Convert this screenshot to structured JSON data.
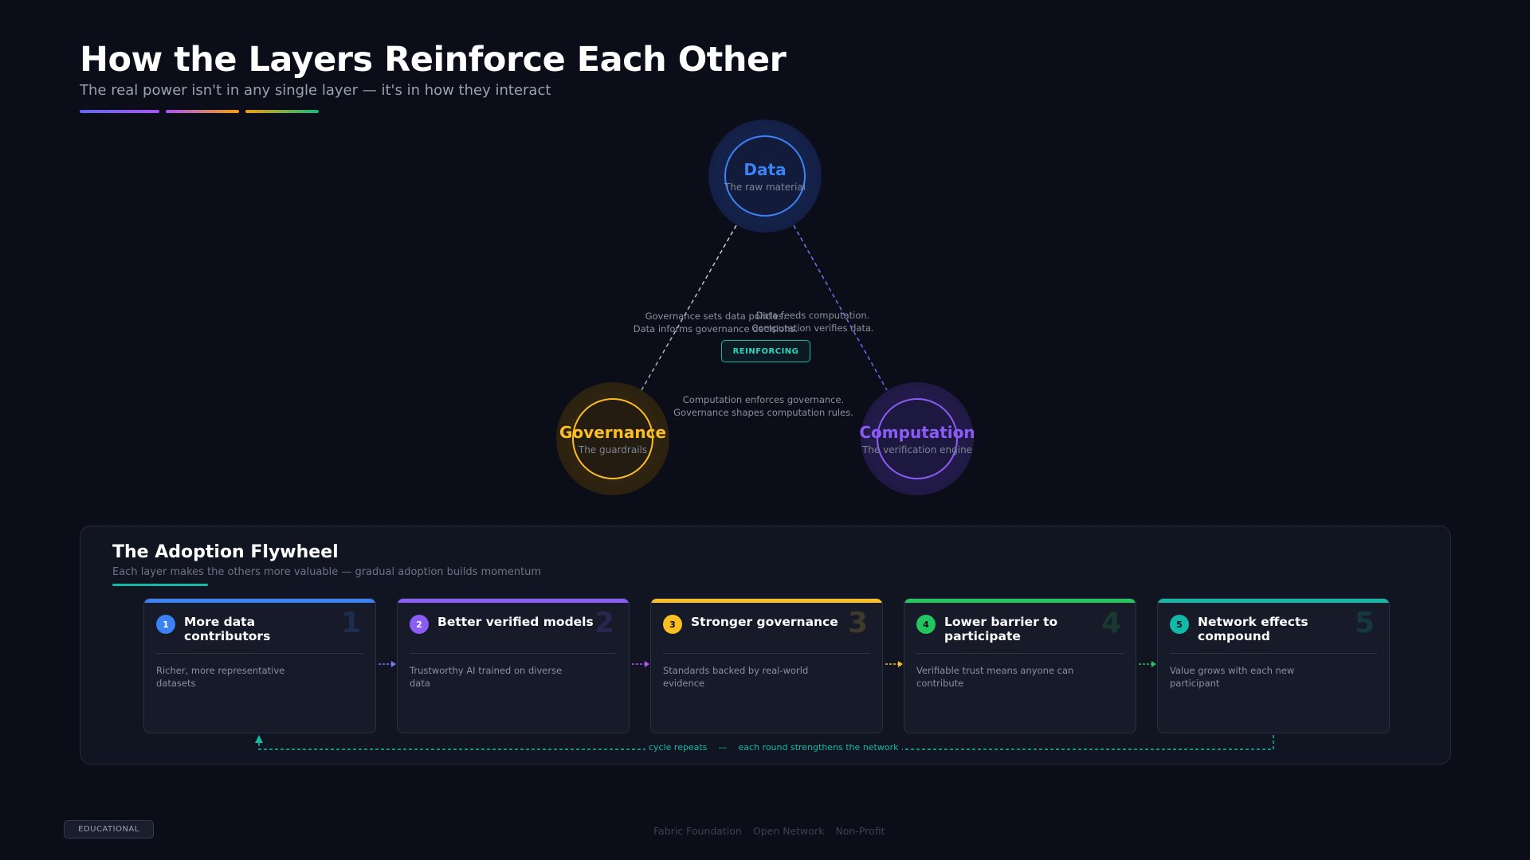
{
  "header": {
    "title": "How the Layers Reinforce Each Other",
    "subtitle": "The real power isn't in any single layer — it's in how they interact",
    "accent_bars": [
      "#6366f1",
      "#a855f7",
      "#f59e0b",
      "#10b981"
    ]
  },
  "diagram": {
    "nodes": {
      "data": {
        "name": "Data",
        "sub": "The raw material",
        "color": "#3b82f6"
      },
      "governance": {
        "name": "Governance",
        "sub": "The guardrails",
        "color": "#fbbf24"
      },
      "computation": {
        "name": "Computation",
        "sub": "The verification engine",
        "color": "#8b5cf6"
      }
    },
    "edges": {
      "governance_data": {
        "line1": "Governance sets data policies.",
        "line2": "Data informs governance decisions."
      },
      "data_computation": {
        "line1": "Data feeds computation.",
        "line2": "Computation verifies data."
      },
      "computation_governance": {
        "line1": "Computation enforces governance.",
        "line2": "Governance shapes computation rules."
      }
    },
    "center_badge": "REINFORCING"
  },
  "flywheel": {
    "title": "The Adoption Flywheel",
    "subtitle": "Each layer makes the others more valuable — gradual adoption builds momentum",
    "steps": [
      {
        "num": "1",
        "title": "More data contributors",
        "desc": "Richer, more representative datasets",
        "color": "#3b82f6"
      },
      {
        "num": "2",
        "title": "Better verified models",
        "desc": "Trustworthy AI trained on diverse data",
        "color": "#8b5cf6"
      },
      {
        "num": "3",
        "title": "Stronger governance",
        "desc": "Standards backed by real-world evidence",
        "color": "#fbbf24"
      },
      {
        "num": "4",
        "title": "Lower barrier to participate",
        "desc": "Verifiable trust means anyone can contribute",
        "color": "#22c55e"
      },
      {
        "num": "5",
        "title": "Network effects compound",
        "desc": "Value grows with each new participant",
        "color": "#14b8a6"
      }
    ],
    "cycle_label_a": "cycle repeats",
    "cycle_label_b": "each round strengthens the network"
  },
  "footer": {
    "badge": "EDUCATIONAL",
    "items": [
      "Fabric Foundation",
      "Open Network",
      "Non-Profit"
    ]
  }
}
